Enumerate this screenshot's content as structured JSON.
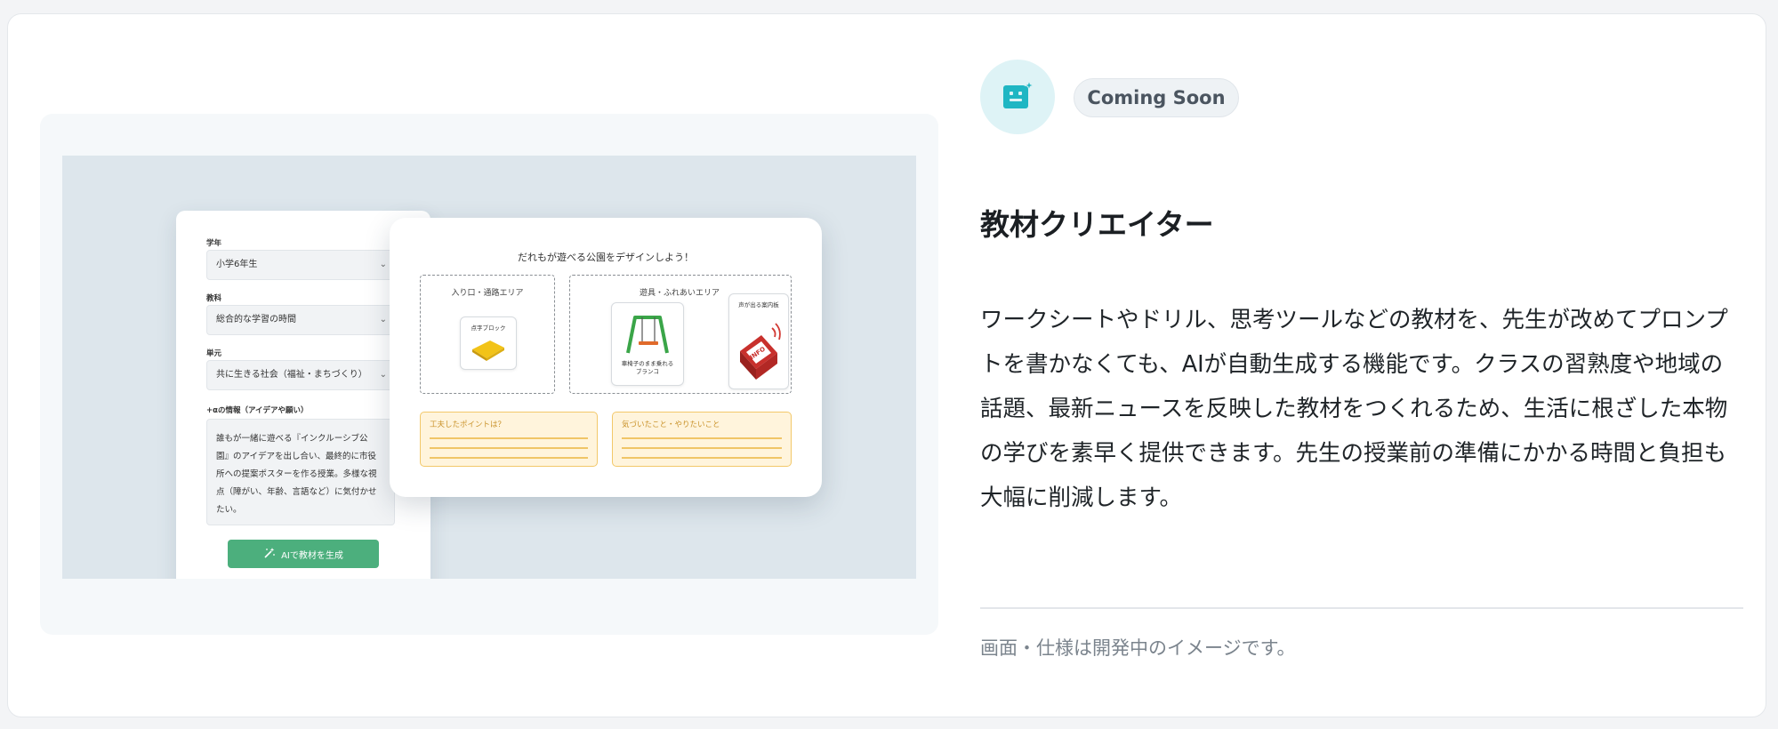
{
  "colors": {
    "accent_teal": "#1fb6c3",
    "generate_button": "#4caf7d",
    "note_yellow": "#f2c86a"
  },
  "feature": {
    "icon": "app-sparkle-icon",
    "badge": "Coming Soon",
    "title": "教材クリエイター",
    "description": "ワークシートやドリル、思考ツールなどの教材を、先生が改めてプロンプトを書かなくても、AIが自動生成する機能です。クラスの習熟度や地域の話題、最新ニュースを反映した教材をつくれるため、生活に根ざした本物の学びを素早く提供できます。先生の授業前の準備にかかる時間と負担も大幅に削減します。",
    "note": "画面・仕様は開発中のイメージです。"
  },
  "form": {
    "grade_label": "学年",
    "grade_value": "小学6年生",
    "subject_label": "教科",
    "subject_value": "総合的な学習の時間",
    "unit_label": "単元",
    "unit_value": "共に生きる社会（福祉・まちづくり）",
    "extra_label": "+αの情報（アイデアや願い）",
    "extra_lines": [
      "誰もが一緒に遊べる『インクルーシブ公",
      "園』のアイデアを出し合い、最終的に市役",
      "所への提案ポスターを作る授業。多様な視",
      "点（障がい、年齢、言語など）に気付かせ",
      "たい。"
    ],
    "generate_button": "AIで教材を生成"
  },
  "worksheet": {
    "title": "だれもが遊べる公園をデザインしよう！",
    "area1_title": "入り口・通路エリア",
    "area1_tile": "点字ブロック",
    "area2_title": "遊具・ふれあいエリア",
    "swing_caption_1": "車椅子のまま乗れる",
    "swing_caption_2": "ブランコ",
    "sign_caption": "声が出る案内板",
    "sign_text": "INFO",
    "box1_title": "工夫したポイントは？",
    "box2_title": "気づいたこと・やりたいこと"
  }
}
